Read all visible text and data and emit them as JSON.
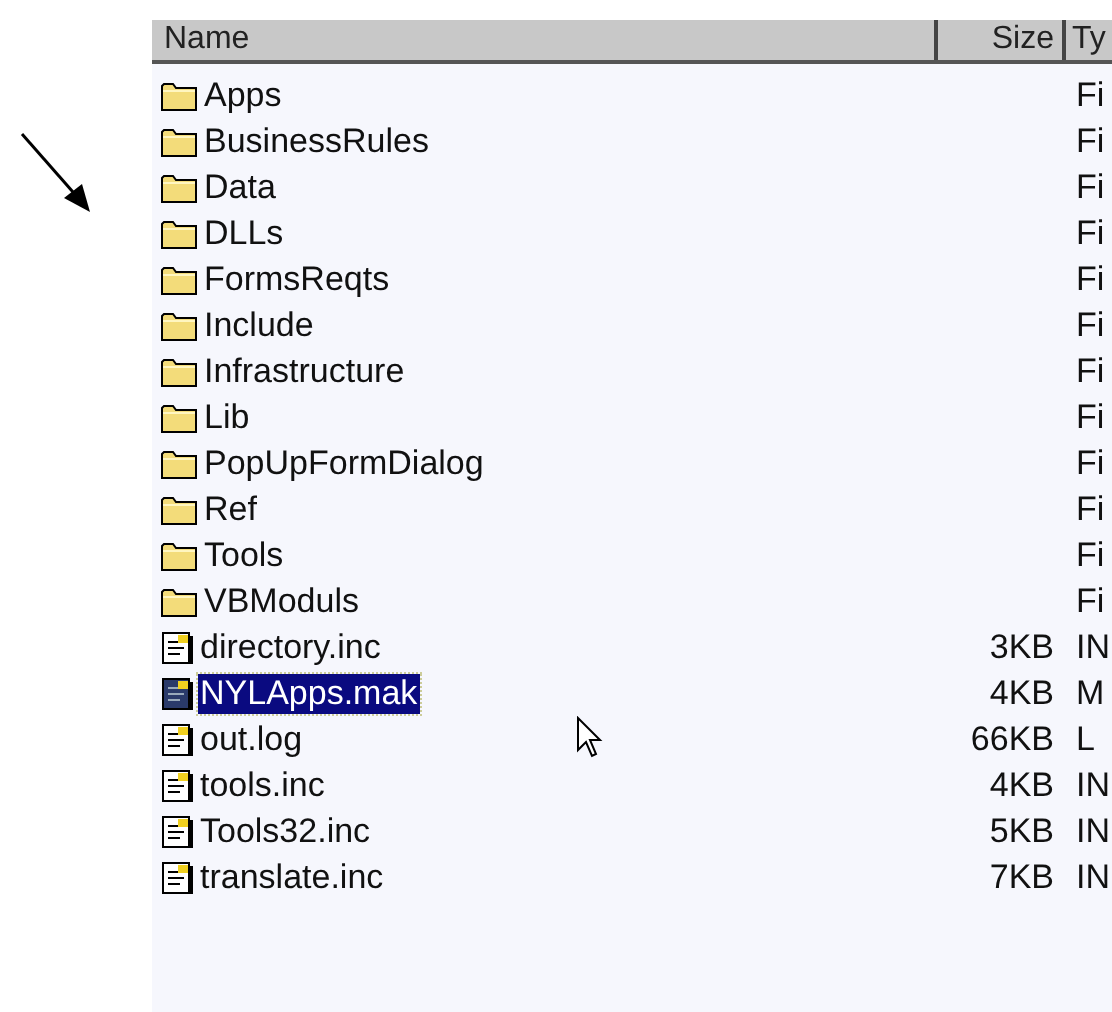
{
  "columns": [
    "Name",
    "Size",
    "Ty"
  ],
  "rows": [
    {
      "kind": "folder",
      "name": "Apps",
      "size": "",
      "type": "Fi",
      "selected": false
    },
    {
      "kind": "folder",
      "name": "BusinessRules",
      "size": "",
      "type": "Fi",
      "selected": false
    },
    {
      "kind": "folder",
      "name": "Data",
      "size": "",
      "type": "Fi",
      "selected": false
    },
    {
      "kind": "folder",
      "name": "DLLs",
      "size": "",
      "type": "Fi",
      "selected": false
    },
    {
      "kind": "folder",
      "name": "FormsReqts",
      "size": "",
      "type": "Fi",
      "selected": false
    },
    {
      "kind": "folder",
      "name": "Include",
      "size": "",
      "type": "Fi",
      "selected": false
    },
    {
      "kind": "folder",
      "name": "Infrastructure",
      "size": "",
      "type": "Fi",
      "selected": false
    },
    {
      "kind": "folder",
      "name": "Lib",
      "size": "",
      "type": "Fi",
      "selected": false
    },
    {
      "kind": "folder",
      "name": "PopUpFormDialog",
      "size": "",
      "type": "Fi",
      "selected": false
    },
    {
      "kind": "folder",
      "name": "Ref",
      "size": "",
      "type": "Fi",
      "selected": false
    },
    {
      "kind": "folder",
      "name": "Tools",
      "size": "",
      "type": "Fi",
      "selected": false
    },
    {
      "kind": "folder",
      "name": "VBModuls",
      "size": "",
      "type": "Fi",
      "selected": false
    },
    {
      "kind": "file",
      "name": "directory.inc",
      "size": "3KB",
      "type": "IN",
      "selected": false
    },
    {
      "kind": "file",
      "name": "NYLApps.mak",
      "size": "4KB",
      "type": "M",
      "selected": true
    },
    {
      "kind": "file",
      "name": "out.log",
      "size": "66KB",
      "type": "L",
      "selected": false
    },
    {
      "kind": "file",
      "name": "tools.inc",
      "size": "4KB",
      "type": "IN",
      "selected": false
    },
    {
      "kind": "file",
      "name": "Tools32.inc",
      "size": "5KB",
      "type": "IN",
      "selected": false
    },
    {
      "kind": "file",
      "name": "translate.inc",
      "size": "7KB",
      "type": "IN",
      "selected": false
    }
  ]
}
